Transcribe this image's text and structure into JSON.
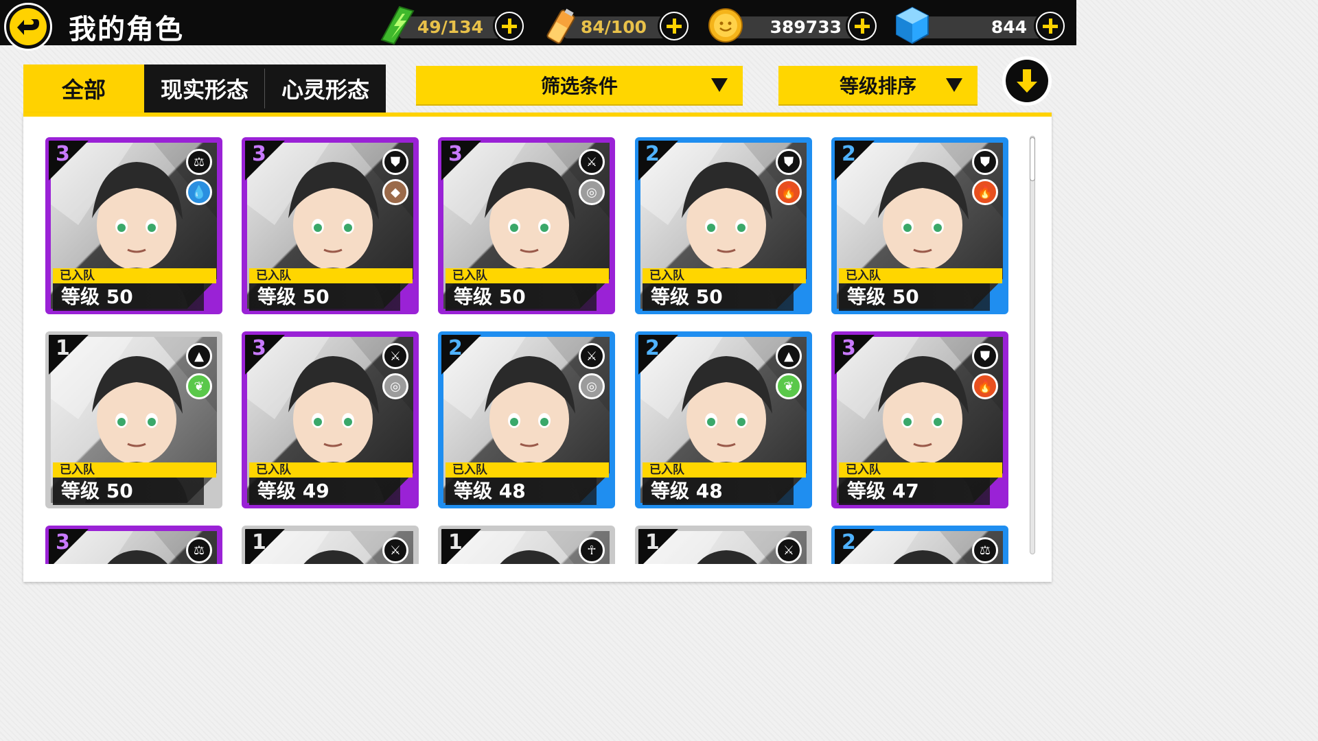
{
  "header": {
    "title": "我的角色",
    "resources": [
      {
        "name": "stamina",
        "value": "49/134",
        "icon": "green-lightning-icon",
        "color": "#e8c14a"
      },
      {
        "name": "battery",
        "value": "84/100",
        "icon": "battery-icon",
        "color": "#e8c14a"
      },
      {
        "name": "coins",
        "value": "389733",
        "icon": "gold-coin-icon",
        "color": "#ffffff"
      },
      {
        "name": "gems",
        "value": "844",
        "icon": "blue-cube-icon",
        "color": "#ffffff"
      }
    ]
  },
  "tabs": [
    {
      "label": "全部",
      "active": true
    },
    {
      "label": "现实形态",
      "active": false
    },
    {
      "label": "心灵形态",
      "active": false
    }
  ],
  "filters": {
    "filter_label": "筛选条件",
    "sort_label": "等级排序"
  },
  "colors": {
    "accent": "#ffd600",
    "rank3": "#9a22d6",
    "rank2": "#1f8ef0",
    "rank1": "#c9c9c9"
  },
  "cards": [
    {
      "rank": "3",
      "team": "已入队",
      "level": "等级 50",
      "role_icon": "scales-icon",
      "element_icon": "water-drop-icon",
      "element_color": "#2a8fe0",
      "frame": "purple"
    },
    {
      "rank": "3",
      "team": "已入队",
      "level": "等级 50",
      "role_icon": "shield-icon",
      "element_icon": "earth-rock-icon",
      "element_color": "#9b6a4a",
      "frame": "purple"
    },
    {
      "rank": "3",
      "team": "已入队",
      "level": "等级 50",
      "role_icon": "sword-icon",
      "element_icon": "wind-swirl-icon",
      "element_color": "#9c9c9c",
      "frame": "purple"
    },
    {
      "rank": "2",
      "team": "已入队",
      "level": "等级 50",
      "role_icon": "shield-icon",
      "element_icon": "fire-icon",
      "element_color": "#e8501f",
      "frame": "blue"
    },
    {
      "rank": "2",
      "team": "已入队",
      "level": "等级 50",
      "role_icon": "shield-icon",
      "element_icon": "fire-icon",
      "element_color": "#e8501f",
      "frame": "blue"
    },
    {
      "rank": "1",
      "team": "已入队",
      "level": "等级 50",
      "role_icon": "triforce-icon",
      "element_icon": "leaf-icon",
      "element_color": "#5ac84a",
      "frame": "gray"
    },
    {
      "rank": "3",
      "team": "已入队",
      "level": "等级 49",
      "role_icon": "sword-icon",
      "element_icon": "wind-swirl-icon",
      "element_color": "#9c9c9c",
      "frame": "purple"
    },
    {
      "rank": "2",
      "team": "已入队",
      "level": "等级 48",
      "role_icon": "sword-icon",
      "element_icon": "wind-swirl-icon",
      "element_color": "#9c9c9c",
      "frame": "blue"
    },
    {
      "rank": "2",
      "team": "已入队",
      "level": "等级 48",
      "role_icon": "triforce-icon",
      "element_icon": "leaf-icon",
      "element_color": "#5ac84a",
      "frame": "blue"
    },
    {
      "rank": "3",
      "team": "已入队",
      "level": "等级 47",
      "role_icon": "shield-icon",
      "element_icon": "fire-icon",
      "element_color": "#e8501f",
      "frame": "purple"
    },
    {
      "rank": "3",
      "team": "",
      "level": "",
      "role_icon": "scales-icon",
      "element_icon": "",
      "element_color": "",
      "frame": "purple"
    },
    {
      "rank": "1",
      "team": "",
      "level": "",
      "role_icon": "sword-icon",
      "element_icon": "",
      "element_color": "",
      "frame": "gray"
    },
    {
      "rank": "1",
      "team": "",
      "level": "",
      "role_icon": "ankh-icon",
      "element_icon": "",
      "element_color": "",
      "frame": "gray"
    },
    {
      "rank": "1",
      "team": "",
      "level": "",
      "role_icon": "sword-icon",
      "element_icon": "",
      "element_color": "",
      "frame": "gray"
    },
    {
      "rank": "2",
      "team": "",
      "level": "",
      "role_icon": "scales-icon",
      "element_icon": "",
      "element_color": "",
      "frame": "blue"
    }
  ]
}
